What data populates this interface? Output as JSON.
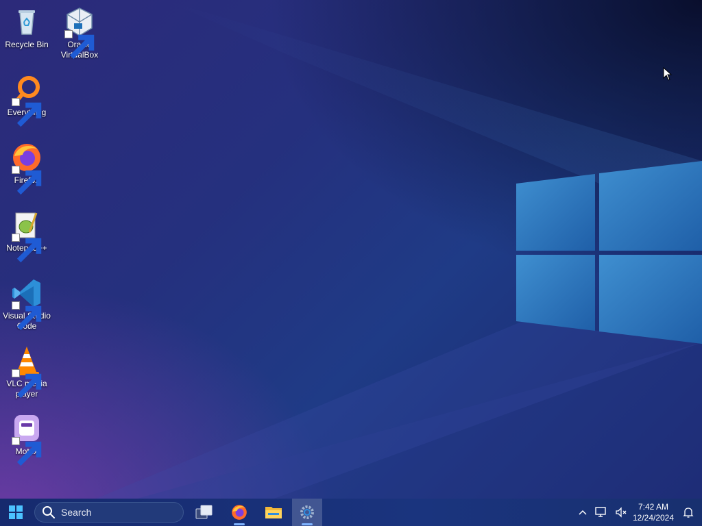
{
  "desktop": {
    "icons": [
      {
        "label": "Recycle Bin",
        "icon": "recycle-bin-icon",
        "shortcut": false
      },
      {
        "label": "Oracle VirtualBox",
        "icon": "virtualbox-icon",
        "shortcut": true
      },
      {
        "label": "Everything",
        "icon": "everything-search-icon",
        "shortcut": true
      },
      {
        "label": "Firefox",
        "icon": "firefox-icon",
        "shortcut": true
      },
      {
        "label": "Notepad++",
        "icon": "notepad-plus-plus-icon",
        "shortcut": true
      },
      {
        "label": "Visual Studio Code",
        "icon": "vscode-icon",
        "shortcut": true
      },
      {
        "label": "VLC media player",
        "icon": "vlc-icon",
        "shortcut": true
      },
      {
        "label": "Motrix",
        "icon": "motrix-icon",
        "shortcut": true
      }
    ]
  },
  "taskbar": {
    "search_placeholder": "Search",
    "apps": [
      {
        "name": "Task View",
        "icon": "task-view-icon",
        "active": false,
        "running": false
      },
      {
        "name": "Firefox",
        "icon": "firefox-icon",
        "active": false,
        "running": true
      },
      {
        "name": "File Explorer",
        "icon": "file-explorer-icon",
        "active": false,
        "running": false
      },
      {
        "name": "Settings",
        "icon": "settings-gear-icon",
        "active": true,
        "running": true
      }
    ],
    "tray": {
      "time": "7:42 AM",
      "date": "12/24/2024",
      "icons": [
        "chevron-up-icon",
        "network-icon",
        "volume-muted-icon",
        "notification-bell-icon"
      ]
    }
  },
  "colors": {
    "taskbar": "#1a347e",
    "accent": "#2f8ee0"
  }
}
